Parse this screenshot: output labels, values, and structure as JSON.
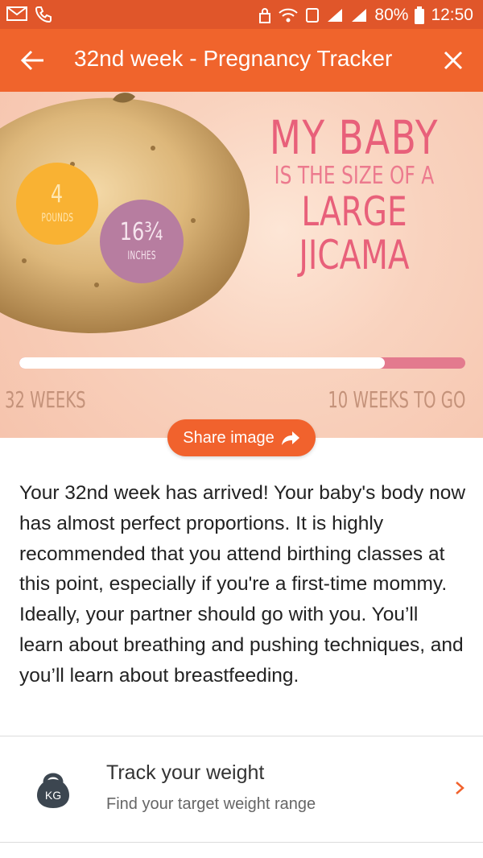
{
  "status_bar": {
    "battery": "80%",
    "time": "12:50"
  },
  "app_bar": {
    "title": "32nd week - Pregnancy Tracker"
  },
  "hero": {
    "weight_value": "4",
    "weight_unit": "POUNDS",
    "length_value": "16¾",
    "length_unit": "INCHES",
    "headline_line1": "MY BABY",
    "headline_line2": "IS THE SIZE OF A",
    "headline_line3": "LARGE JICAMA",
    "progress_fraction": 0.82,
    "weeks_done_label": "32 WEEKS",
    "weeks_left_label": "10 WEEKS TO GO",
    "share_label": "Share image"
  },
  "article": {
    "text": "Your 32nd week has arrived! Your baby's body now has almost perfect proportions. It is highly recommended that you attend birthing classes at this point, especially if you're a first-time mommy. Ideally, your partner should go with you. You’ll learn about breathing and pushing techniques, and you’ll learn about breastfeeding."
  },
  "weight_tracker": {
    "icon_label": "KG",
    "title": "Track your weight",
    "subtitle": "Find your target weight range"
  },
  "colors": {
    "status_bar": "#e0562a",
    "app_bar": "#f0642c",
    "accent": "#f1622d",
    "headline": "#e8607a"
  }
}
